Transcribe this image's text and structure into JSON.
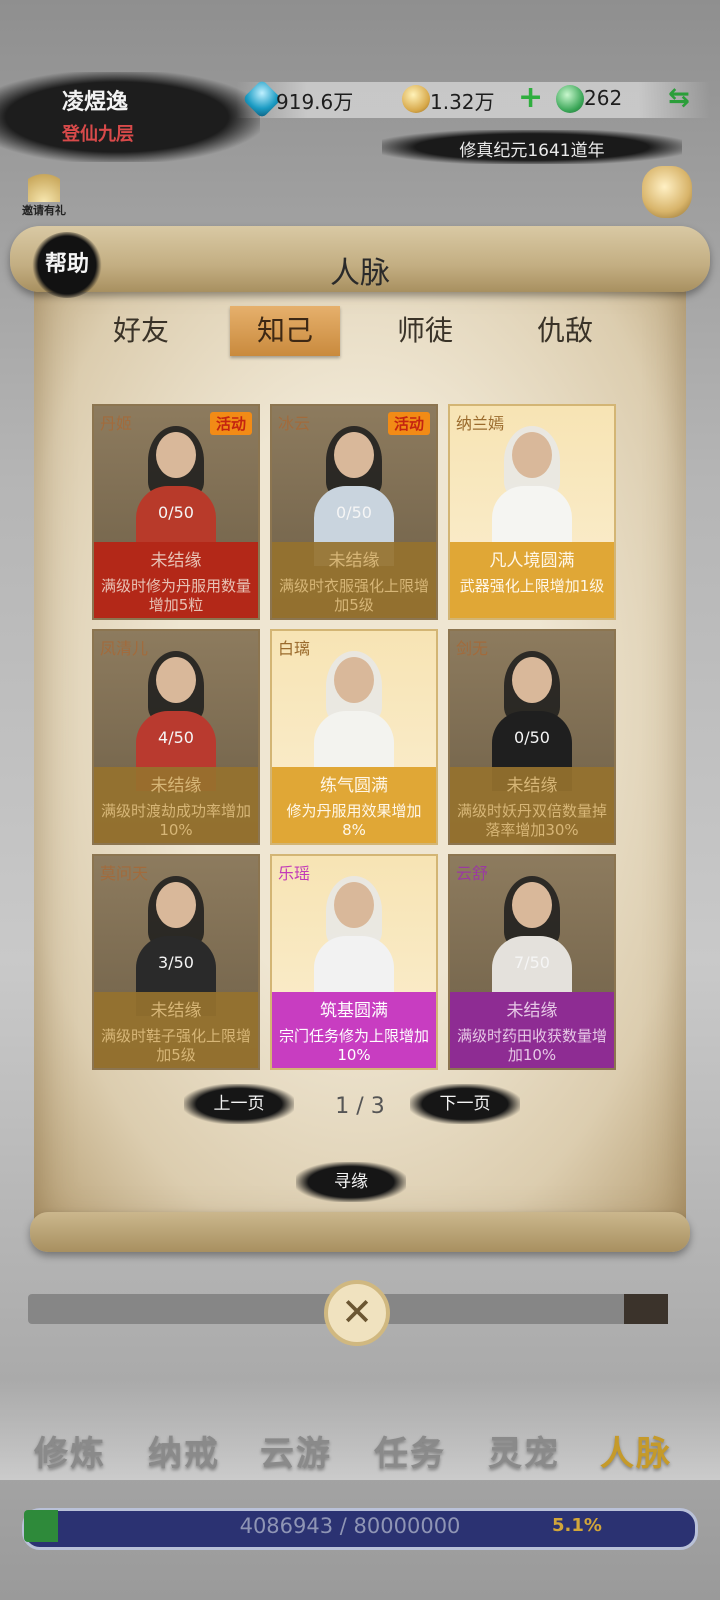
{
  "player": {
    "name": "凌煜逸",
    "realm": "登仙九层"
  },
  "resources": {
    "spirit_stone": "919.6万",
    "coin": "1.32万",
    "jade": "262",
    "plus_label": "+",
    "swap_label": "⇆"
  },
  "era": "修真纪元1641道年",
  "invite_label": "邀请有礼",
  "panel": {
    "help_label": "帮助",
    "title": "人脉",
    "tabs": [
      "好友",
      "知己",
      "师徒",
      "仇敌"
    ],
    "active_tab": "知己"
  },
  "cards": [
    {
      "name": "丹姬",
      "badge": "活动",
      "progress": "0/50",
      "status": "未结缘",
      "effect": "满级时修为丹服用数量增加5粒",
      "style": "red"
    },
    {
      "name": "冰云",
      "badge": "活动",
      "progress": "0/50",
      "status": "未结缘",
      "effect": "满级时衣服强化上限增加5级",
      "style": "dim"
    },
    {
      "name": "纳兰嫣",
      "badge": "",
      "progress": "",
      "status": "凡人境圆满",
      "effect": "武器强化上限增加1级",
      "style": "gold"
    },
    {
      "name": "凤清儿",
      "badge": "",
      "progress": "4/50",
      "status": "未结缘",
      "effect": "满级时渡劫成功率增加10%",
      "style": "dim"
    },
    {
      "name": "白璃",
      "badge": "",
      "progress": "",
      "status": "练气圆满",
      "effect": "修为丹服用效果增加8%",
      "style": "gold"
    },
    {
      "name": "剑无",
      "badge": "",
      "progress": "0/50",
      "status": "未结缘",
      "effect": "满级时妖丹双倍数量掉落率增加30%",
      "style": "dim"
    },
    {
      "name": "莫问天",
      "badge": "",
      "progress": "3/50",
      "status": "未结缘",
      "effect": "满级时鞋子强化上限增加5级",
      "style": "dim"
    },
    {
      "name": "乐瑶",
      "badge": "",
      "progress": "",
      "status": "筑基圆满",
      "effect": "宗门任务修为上限增加10%",
      "style": "magenta"
    },
    {
      "name": "云舒",
      "badge": "",
      "progress": "7/50",
      "status": "未结缘",
      "effect": "满级时药田收获数量增加10%",
      "style": "purple"
    }
  ],
  "pagination": {
    "prev_label": "上一页",
    "page": "1 / 3",
    "next_label": "下一页"
  },
  "seek_label": "寻缘",
  "close_icon": "close-icon",
  "bottom_nav": [
    "修炼",
    "纳戒",
    "云游",
    "任务",
    "灵宠",
    "人脉"
  ],
  "active_nav": "人脉",
  "experience": {
    "text": "4086943 / 80000000",
    "percent": "5.1%",
    "fill_fraction": 0.051
  },
  "colors": {
    "accent_gold": "#c59a2a",
    "realm_red": "#d84a4a",
    "tab_active": "#d9a059"
  }
}
